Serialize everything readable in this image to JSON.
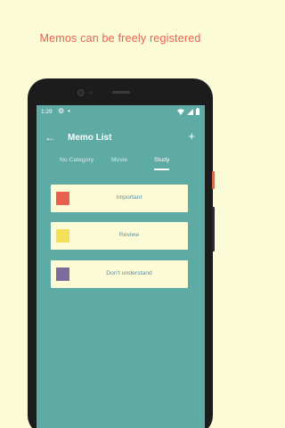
{
  "promo": {
    "headline": "Memos can be freely registered"
  },
  "status_bar": {
    "time": "1:29",
    "settings_glyph": "⚙",
    "dot_glyph": "•"
  },
  "app_bar": {
    "back_glyph": "←",
    "title": "Memo List",
    "add_glyph": "+"
  },
  "tabs": [
    {
      "label": "No Category",
      "active": false
    },
    {
      "label": "Movie",
      "active": false
    },
    {
      "label": "Study",
      "active": true
    }
  ],
  "memos": [
    {
      "label": "Important",
      "color": "#e8604f"
    },
    {
      "label": "Review",
      "color": "#f2e05a"
    },
    {
      "label": "Don't understand",
      "color": "#7b6c9e"
    }
  ],
  "colors": {
    "background": "#fbfbd8",
    "screen": "#5eaaa4",
    "card": "#fdfbd6",
    "accent": "#e8604f"
  }
}
